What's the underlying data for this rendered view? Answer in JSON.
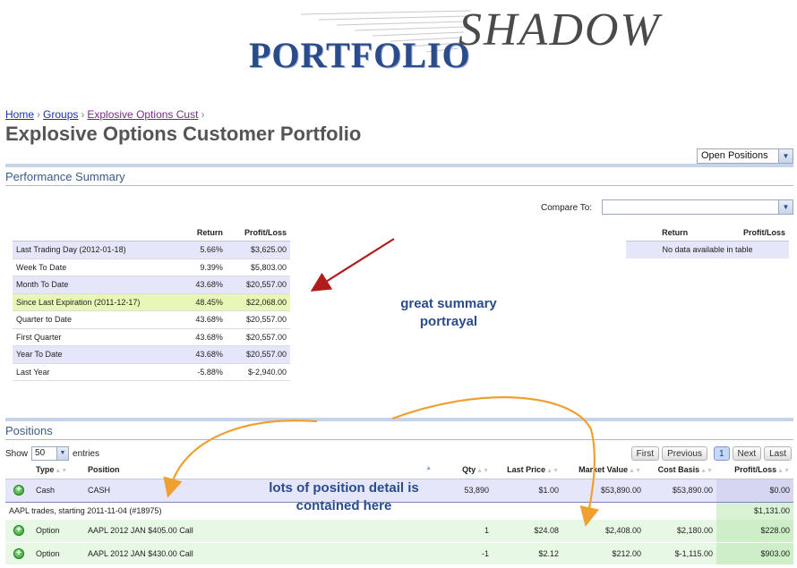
{
  "logo": {
    "word1": "PORTFOLIO",
    "word2": "SHADOW"
  },
  "breadcrumb": {
    "home": "Home",
    "groups": "Groups",
    "current": "Explosive Options Cust",
    "separator": "›"
  },
  "page_title": "Explosive Options Customer Portfolio",
  "view_select": {
    "value": "Open Positions"
  },
  "performance": {
    "title": "Performance Summary",
    "headers": {
      "return": "Return",
      "profit_loss": "Profit/Loss"
    },
    "rows": [
      {
        "label": "Last Trading Day (2012-01-18)",
        "return": "5.66%",
        "pl": "$3,625.00"
      },
      {
        "label": "Week To Date",
        "return": "9.39%",
        "pl": "$5,803.00"
      },
      {
        "label": "Month To Date",
        "return": "43.68%",
        "pl": "$20,557.00"
      },
      {
        "label": "Since Last Expiration (2011-12-17)",
        "return": "48.45%",
        "pl": "$22,068.00"
      },
      {
        "label": "Quarter to Date",
        "return": "43.68%",
        "pl": "$20,557.00"
      },
      {
        "label": "First Quarter",
        "return": "43.68%",
        "pl": "$20,557.00"
      },
      {
        "label": "Year To Date",
        "return": "43.68%",
        "pl": "$20,557.00"
      },
      {
        "label": "Last Year",
        "return": "-5.88%",
        "pl": "$-2,940.00"
      }
    ],
    "compare": {
      "label": "Compare To:",
      "value": "",
      "empty": "No data available in table"
    }
  },
  "annotations": {
    "summary": [
      "great summary",
      "portrayal"
    ],
    "positions": [
      "lots of position detail is",
      "contained here"
    ],
    "arrow_color": "#b01c1c",
    "curve_color": "#f0a030"
  },
  "positions": {
    "title": "Positions",
    "show_label": "Show",
    "page_size": "50",
    "entries_label": "entries",
    "pager": {
      "first": "First",
      "previous": "Previous",
      "current": "1",
      "next": "Next",
      "last": "Last"
    },
    "headers": {
      "type": "Type",
      "position": "Position",
      "qty": "Qty",
      "last_price": "Last Price",
      "market_value": "Market Value",
      "cost_basis": "Cost Basis",
      "profit_loss": "Profit/Loss"
    },
    "cash_row": {
      "type": "Cash",
      "position": "CASH",
      "qty": "53,890",
      "last_price": "$1.00",
      "market_value": "$53,890.00",
      "cost_basis": "$53,890.00",
      "pl": "$0.00"
    },
    "group_row": {
      "label": "AAPL trades, starting 2011-11-04 (#18975)",
      "pl": "$1,131.00"
    },
    "option_rows": [
      {
        "type": "Option",
        "position": "AAPL 2012 JAN $405.00 Call",
        "qty": "1",
        "last_price": "$24.08",
        "market_value": "$2,408.00",
        "cost_basis": "$2,180.00",
        "pl": "$228.00"
      },
      {
        "type": "Option",
        "position": "AAPL 2012 JAN $430.00 Call",
        "qty": "-1",
        "last_price": "$2.12",
        "market_value": "$212.00",
        "cost_basis": "$-1,115.00",
        "pl": "$903.00"
      }
    ]
  }
}
